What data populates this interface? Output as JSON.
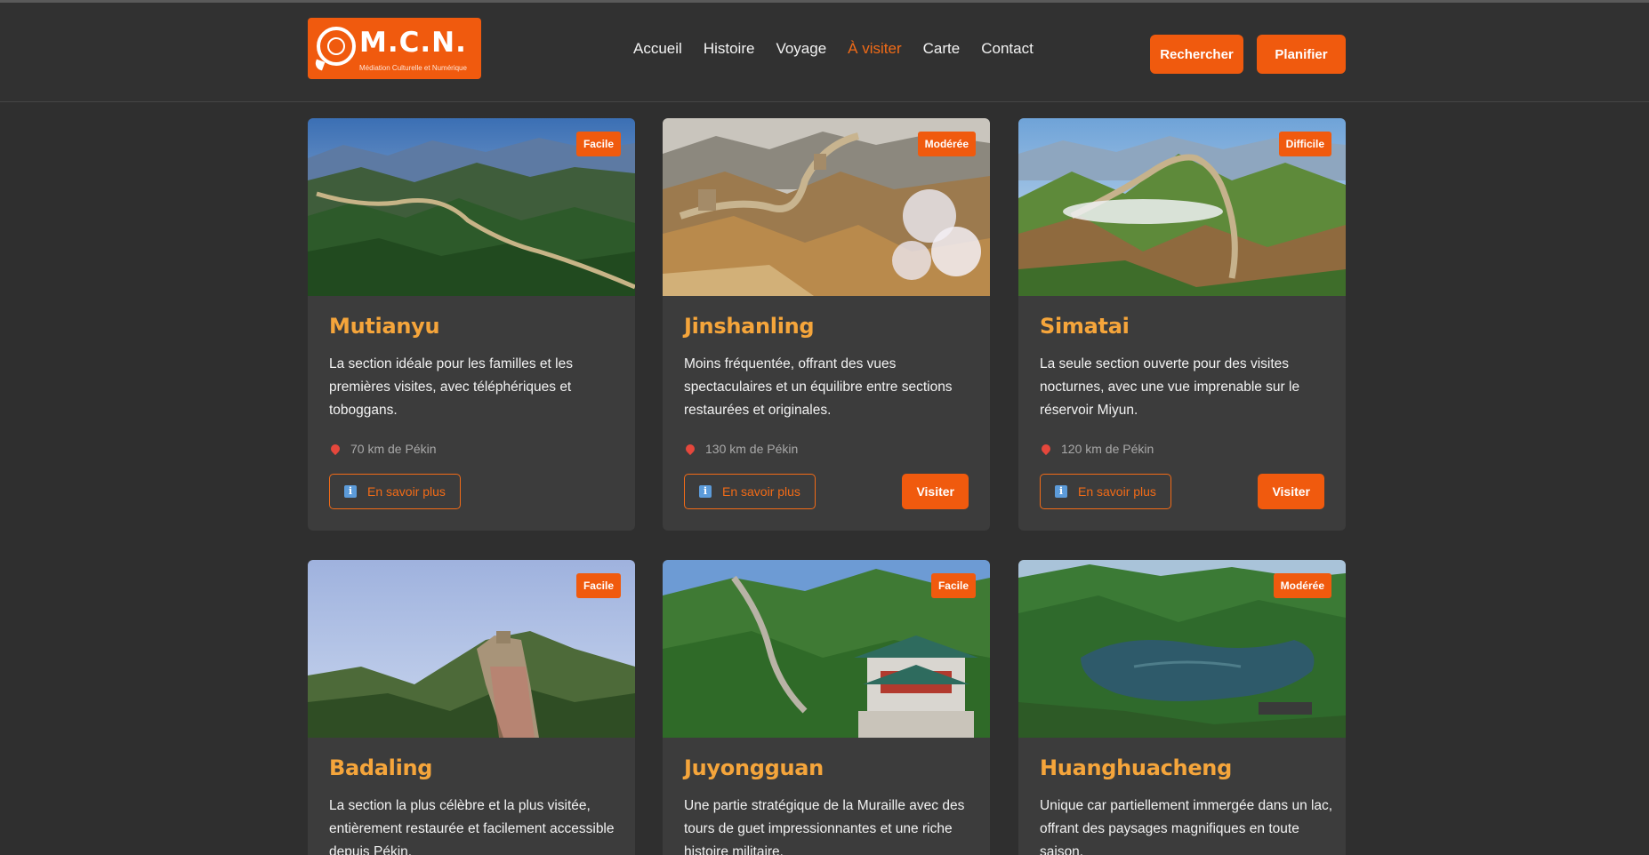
{
  "logo": {
    "title": "M.C.N.",
    "subtitle": "Médiation Culturelle et Numérique"
  },
  "nav": {
    "items": [
      {
        "label": "Accueil"
      },
      {
        "label": "Histoire"
      },
      {
        "label": "Voyage"
      },
      {
        "label": "À visiter"
      },
      {
        "label": "Carte"
      },
      {
        "label": "Contact"
      }
    ],
    "active": "À visiter"
  },
  "header_buttons": {
    "search_label": "Rechercher",
    "plan_label": "Planifier"
  },
  "colors": {
    "accent": "#f05a0e",
    "title": "#f5a53b",
    "background": "#2f2f2f",
    "card": "#3c3c3c"
  },
  "cards": [
    {
      "title": "Mutianyu",
      "difficulty": "Facile",
      "description": "La section idéale pour les familles et les premières visites, avec téléphériques et toboggans.",
      "distance": "70 km de Pékin",
      "more_label": "En savoir plus",
      "visit_label": ""
    },
    {
      "title": "Jinshanling",
      "difficulty": "Modérée",
      "description": "Moins fréquentée, offrant des vues spectaculaires et un équilibre entre sections restaurées et originales.",
      "distance": "130 km de Pékin",
      "more_label": "En savoir plus",
      "visit_label": "Visiter"
    },
    {
      "title": "Simatai",
      "difficulty": "Difficile",
      "description": "La seule section ouverte pour des visites nocturnes, avec une vue imprenable sur le réservoir Miyun.",
      "distance": "120 km de Pékin",
      "more_label": "En savoir plus",
      "visit_label": "Visiter"
    },
    {
      "title": "Badaling",
      "difficulty": "Facile",
      "description": "La section la plus célèbre et la plus visitée, entièrement restaurée et facilement accessible depuis Pékin."
    },
    {
      "title": "Juyongguan",
      "difficulty": "Facile",
      "description": "Une partie stratégique de la Muraille avec des tours de guet impressionnantes et une riche histoire militaire."
    },
    {
      "title": "Huanghuacheng",
      "difficulty": "Modérée",
      "description": "Unique car partiellement immergée dans un lac, offrant des paysages magnifiques en toute saison."
    }
  ]
}
